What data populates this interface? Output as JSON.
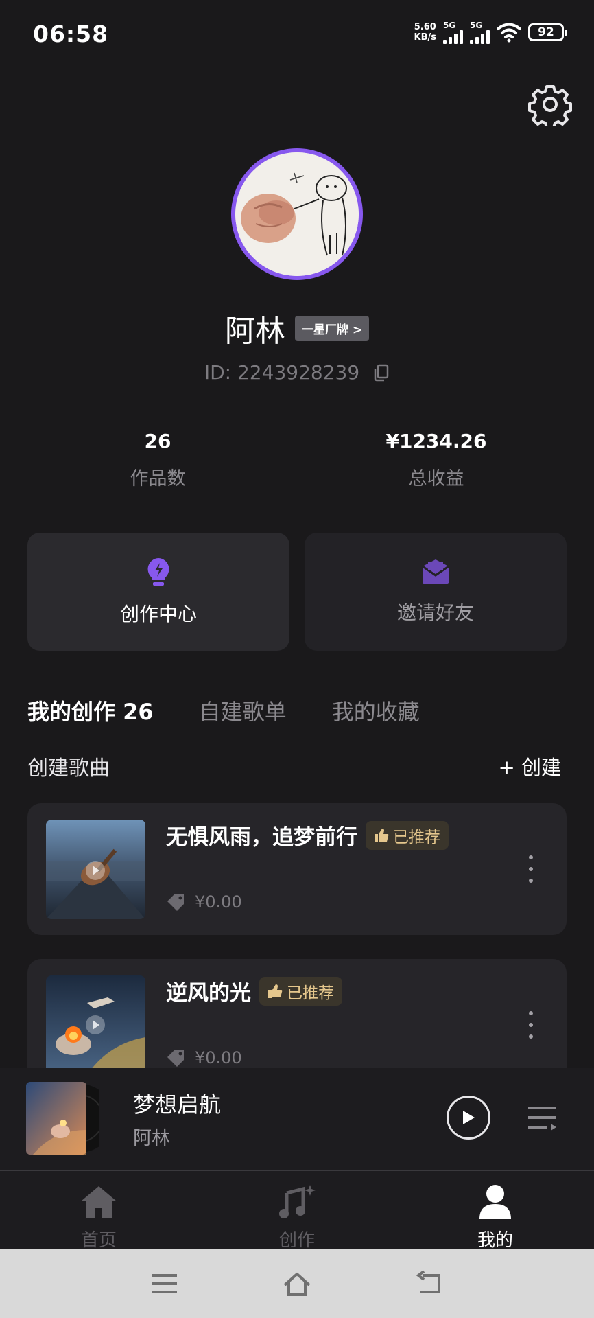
{
  "status_bar": {
    "time": "06:58",
    "net_speed_value": "5.60",
    "net_speed_unit": "KB/s",
    "sim1": "5G",
    "sim2": "5G",
    "battery": "92"
  },
  "profile": {
    "name": "阿林",
    "badge": "一星厂牌 >",
    "id_text": "ID: 2243928239"
  },
  "stats": [
    {
      "value": "26",
      "label": "作品数"
    },
    {
      "value": "¥1234.26",
      "label": "总收益"
    }
  ],
  "cards": [
    {
      "label": "创作中心",
      "icon": "lightbulb-icon"
    },
    {
      "label": "邀请好友",
      "icon": "envelope-icon"
    }
  ],
  "tabs": [
    {
      "label": "我的创作 26"
    },
    {
      "label": "自建歌单"
    },
    {
      "label": "我的收藏"
    }
  ],
  "section": {
    "title": "创建歌曲",
    "create": "+ 创建"
  },
  "songs": [
    {
      "title": "无惧风雨，追梦前行",
      "badge": "已推荐",
      "price": "¥0.00"
    },
    {
      "title": "逆风的光",
      "badge": "已推荐",
      "price": "¥0.00"
    }
  ],
  "player": {
    "title": "梦想启航",
    "artist": "阿林"
  },
  "nav": [
    {
      "label": "首页",
      "icon": "home-icon"
    },
    {
      "label": "创作",
      "icon": "music-create-icon"
    },
    {
      "label": "我的",
      "icon": "profile-icon"
    }
  ],
  "colors": {
    "background": "#1a191b",
    "accent": "#8758ee",
    "badge_gold": "#e5c78d"
  }
}
